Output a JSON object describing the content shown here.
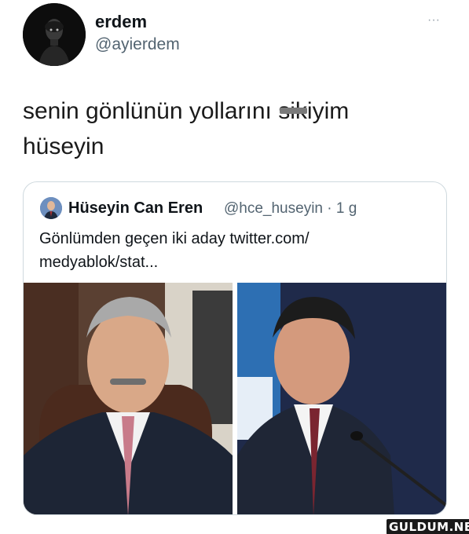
{
  "tweet": {
    "author_name": "erdem",
    "author_handle": "@ayierdem",
    "more_icon": "···",
    "text_before": "senin gönlünün yollarını ",
    "text_censored": "sik",
    "text_after": "iyim",
    "text_line2": "hüseyin"
  },
  "quoted_tweet": {
    "author_name": "Hüseyin Can Eren",
    "meta": "@hce_huseyin · 1 g",
    "text_line1": "Gönlümden geçen iki aday twitter.com/",
    "text_line2": "medyablok/stat..."
  },
  "watermark": "GULDUM.NET",
  "colors": {
    "text": "#0f1419",
    "secondary": "#536471",
    "border": "#cfd9de"
  }
}
